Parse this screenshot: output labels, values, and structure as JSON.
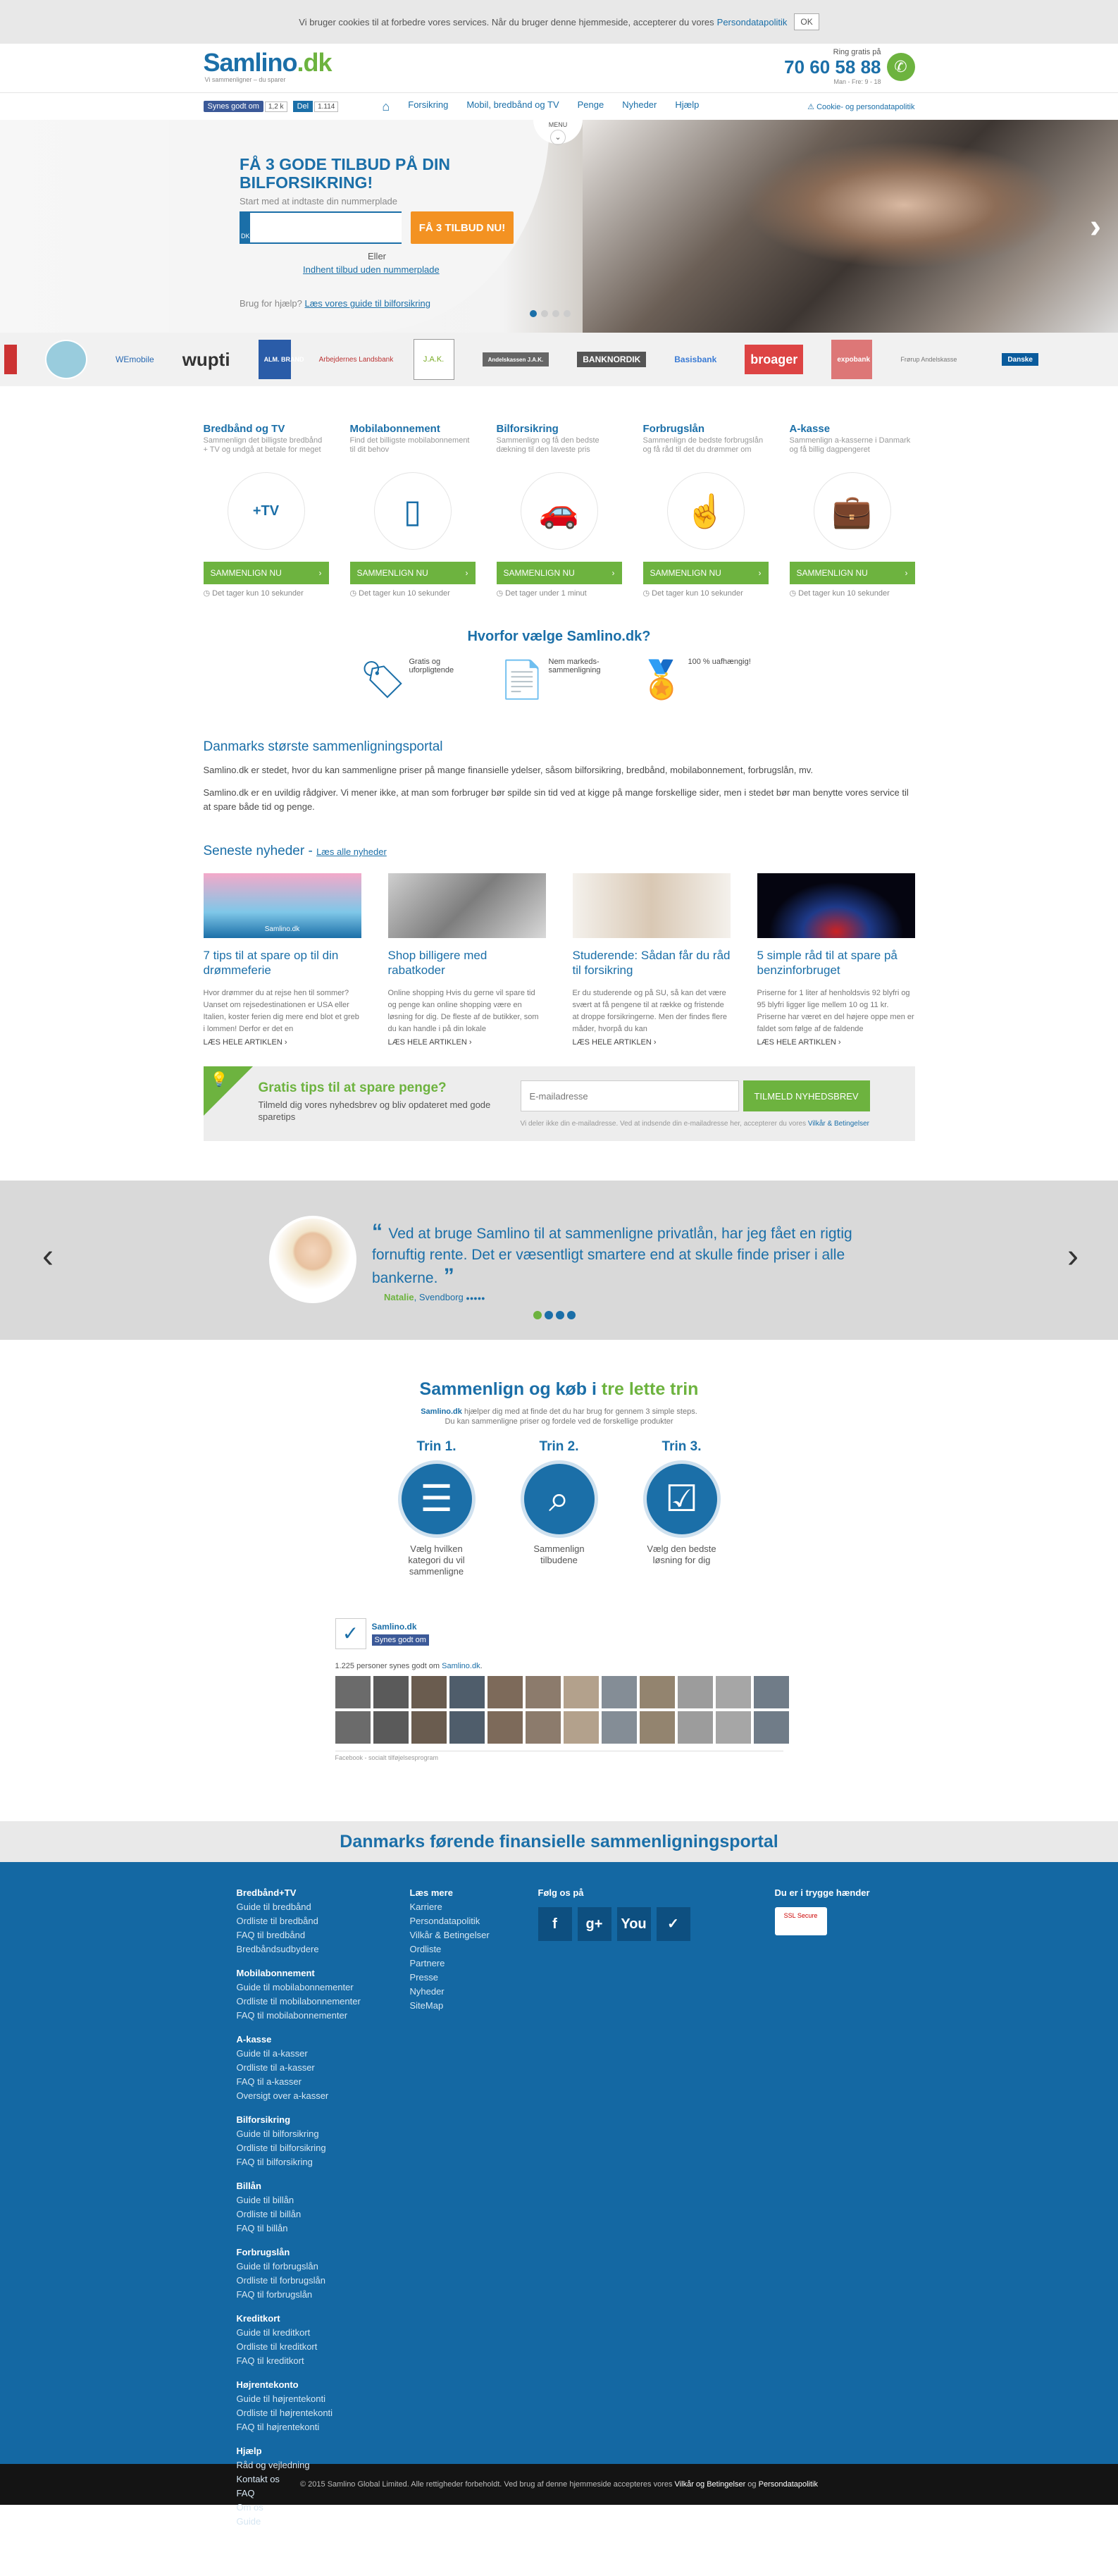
{
  "cookie_bar": {
    "text": "Vi bruger cookies til at forbedre vores services. Når du bruger denne hjemmeside, accepterer du vores",
    "link": "Persondatapolitik",
    "ok": "OK"
  },
  "header": {
    "logo_main": "Samlino",
    "logo_tld": ".dk",
    "tagline": "Vi sammenligner – du sparer",
    "phone_label": "Ring gratis på",
    "phone": "70 60 58 88",
    "hours": "Man - Fre: 9 - 18"
  },
  "nav": {
    "fb_label": "Synes godt om",
    "fb_count": "1,2 k",
    "in_label": "Del",
    "in_count": "1.114",
    "items": [
      "Forsikring",
      "Mobil, bredbånd og TV",
      "Penge",
      "Nyheder",
      "Hjælp"
    ],
    "cookie_link": "Cookie- og persondatapolitik"
  },
  "hero": {
    "title": "FÅ 3 GODE TILBUD PÅ DIN BILFORSIKRING!",
    "subtitle": "Start med at indtaste din nummerplade",
    "plate_country": "DK",
    "cta": "FÅ 3 TILBUD NU!",
    "or": "Eller",
    "no_plate_link": "Indhent tilbud uden nummerplade",
    "help_prefix": "Brug for hjælp?",
    "help_link": "Læs vores guide til bilforsikring",
    "menu_tab": "MENU"
  },
  "partner_logos": [
    "WEmobile",
    "wupti",
    "ALM. BRAND",
    "Arbejdernes Landsbank",
    "J.A.K.",
    "Andelskassen J.A.K.",
    "BANKNORDIK",
    "Basisbank",
    "broager",
    "expobank",
    "Frørup Andelskasse",
    "Danske"
  ],
  "categories": [
    {
      "title": "Bredbånd og TV",
      "desc": "Sammenlign det billigste bredbånd + TV og undgå at betale for meget",
      "btn": "SAMMENLIGN NU",
      "time": "Det tager kun 10 sekunder",
      "icon": "wifi-tv-icon",
      "glyph": "+TV"
    },
    {
      "title": "Mobilabonnement",
      "desc": "Find det billigste mobilabonnement til dit behov",
      "btn": "SAMMENLIGN NU",
      "time": "Det tager kun 10 sekunder",
      "icon": "phone-icon",
      "glyph": "▯"
    },
    {
      "title": "Bilforsikring",
      "desc": "Sammenlign og få den bedste dækning til den laveste pris",
      "btn": "SAMMENLIGN NU",
      "time": "Det tager under 1 minut",
      "icon": "car-icon",
      "glyph": "🚗"
    },
    {
      "title": "Forbrugslån",
      "desc": "Sammenlign de bedste forbrugslån og få råd til det du drømmer om",
      "btn": "SAMMENLIGN NU",
      "time": "Det tager kun 10 sekunder",
      "icon": "hand-person-icon",
      "glyph": "☝"
    },
    {
      "title": "A-kasse",
      "desc": "Sammenlign a-kasserne i Danmark og få billig dagpengeret",
      "btn": "SAMMENLIGN NU",
      "time": "Det tager kun 10 sekunder",
      "icon": "briefcase-icon",
      "glyph": "💼"
    }
  ],
  "why": {
    "title": "Hvorfor vælge Samlino.dk?",
    "items": [
      {
        "text": "Gratis og uforpligtende",
        "icon": "gratis-tag-icon",
        "glyph": "🏷"
      },
      {
        "text": "Nem markeds-sammenligning",
        "icon": "documents-check-icon",
        "glyph": "📄"
      },
      {
        "text": "100 % uafhængig!",
        "icon": "ribbon-award-icon",
        "glyph": "🏅"
      }
    ]
  },
  "portal": {
    "title": "Danmarks største sammenligningsportal",
    "p1": "Samlino.dk er stedet, hvor du kan sammenligne priser på mange finansielle ydelser, såsom bilforsikring, bredbånd, mobilabonnement, forbrugslån, mv.",
    "p2": "Samlino.dk er en uvildig rådgiver. Vi mener ikke, at man som forbruger bør spilde sin tid ved at kigge på mange forskellige sider, men i stedet bør man benytte vores service til at spare både tid og penge."
  },
  "news": {
    "title": "Seneste nyheder",
    "all_link": "Læs alle nyheder",
    "items": [
      {
        "title": "7 tips til at spare op til din drømmeferie",
        "text": "Hvor drømmer du at rejse hen til sommer? Uanset om rejsedestinationen er USA eller Italien, koster ferien dig mere end blot et greb i lommen! Derfor er det en",
        "more": "LÆS HELE ARTIKLEN",
        "img_label": "Samlino.dk",
        "color": "#7fc7e8"
      },
      {
        "title": "Shop billigere med rabatkoder",
        "text": "Online shopping Hvis du gerne vil spare tid og penge kan online shopping være en løsning for dig. De fleste af de butikker, som du kan handle i på din lokale",
        "more": "LÆS HELE ARTIKLEN",
        "img_label": "",
        "color": "#9a9a9a"
      },
      {
        "title": "Studerende: Sådan får du råd til forsikring",
        "text": "Er du studerende og på SU, så kan det være svært at få pengene til at række og fristende at droppe forsikringerne. Men der findes flere måder, hvorpå du kan",
        "more": "LÆS HELE ARTIKLEN",
        "img_label": "",
        "color": "#d9d2c8"
      },
      {
        "title": "5 simple råd til at spare på benzinforbruget",
        "text": "Priserne for 1 liter af henholdsvis 92 blyfri og 95 blyfri ligger lige mellem 10 og 11 kr. Priserne har været en del højere oppe men er faldet som følge af de faldende",
        "more": "LÆS HELE ARTIKLEN",
        "img_label": "",
        "color": "#0a0a1a"
      }
    ]
  },
  "newsletter": {
    "title": "Gratis tips til at spare penge?",
    "text": "Tilmeld dig vores nyhedsbrev og bliv opdateret med gode sparetips",
    "placeholder": "E-mailadresse",
    "button": "TILMELD NYHEDSBREV",
    "fine": "Vi deler ikke din e-mailadresse. Ved at indsende din e-mailadresse her, accepterer du vores",
    "fine_link": "Vilkår & Betingelser"
  },
  "testimonial": {
    "quote": "Ved at bruge Samlino til at sammenligne privatlån, har jeg fået en rigtig fornuftig rente. Det er væsentligt smartere end at skulle finde priser i alle bankerne.",
    "name": "Natalie",
    "city": "Svendborg",
    "stars": "●●●●●"
  },
  "steps": {
    "title_a": "Sammenlign og køb i",
    "title_b": "tre lette trin",
    "brand": "Samlino.dk",
    "sub1": "hjælper dig med at finde det du har brug for gennem 3 simple steps.",
    "sub2": "Du kan sammenligne priser og fordele ved de forskellige produkter",
    "items": [
      {
        "title": "Trin 1.",
        "desc": "Vælg hvilken kategori du vil sammenligne",
        "icon": "checklist-icon",
        "glyph": "☰"
      },
      {
        "title": "Trin 2.",
        "desc": "Sammenlign tilbudene",
        "icon": "magnifier-icon",
        "glyph": "⌕"
      },
      {
        "title": "Trin 3.",
        "desc": "Vælg den bedste løsning for dig",
        "icon": "checkbox-icon",
        "glyph": "☑"
      }
    ]
  },
  "fb_widget": {
    "name": "Samlino.dk",
    "like": "Synes godt om",
    "count_text": "1.225 personer synes godt om",
    "count_link": "Samlino.dk",
    "plugin": "Facebook - socialt tilføjelsesprogram"
  },
  "footer": {
    "headline": "Danmarks førende finansielle sammenligningsportal",
    "col1": [
      {
        "h": "Bredbånd+TV",
        "links": [
          "Guide til bredbånd",
          "Ordliste til bredbånd",
          "FAQ til bredbånd",
          "Bredbåndsudbydere"
        ]
      },
      {
        "h": "Mobilabonnement",
        "links": [
          "Guide til mobilabonnementer",
          "Ordliste til mobilabonnementer",
          "FAQ til mobilabonnementer"
        ]
      },
      {
        "h": "A-kasse",
        "links": [
          "Guide til a-kasser",
          "Ordliste til a-kasser",
          "FAQ til a-kasser",
          "Oversigt over a-kasser"
        ]
      },
      {
        "h": "Bilforsikring",
        "links": [
          "Guide til bilforsikring",
          "Ordliste til bilforsikring",
          "FAQ til bilforsikring"
        ]
      },
      {
        "h": "Billån",
        "links": [
          "Guide til billån",
          "Ordliste til billån",
          "FAQ til billån"
        ]
      },
      {
        "h": "Forbrugslån",
        "links": [
          "Guide til forbrugslån",
          "Ordliste til forbrugslån",
          "FAQ til forbrugslån"
        ]
      },
      {
        "h": "Kreditkort",
        "links": [
          "Guide til kreditkort",
          "Ordliste til kreditkort",
          "FAQ til kreditkort"
        ]
      },
      {
        "h": "Højrentekonto",
        "links": [
          "Guide til højrentekonti",
          "Ordliste til højrentekonti",
          "FAQ til højrentekonti"
        ]
      },
      {
        "h": "Hjælp",
        "links": [
          "Råd og vejledning",
          "Kontakt os",
          "FAQ",
          "Om os",
          "Guide"
        ]
      }
    ],
    "col2": {
      "h": "Læs mere",
      "links": [
        "Karriere",
        "Persondatapolitik",
        "Vilkår & Betingelser",
        "Ordliste",
        "Partnere",
        "Presse",
        "Nyheder",
        "SiteMap"
      ]
    },
    "col3": {
      "h": "Følg os på",
      "social": [
        {
          "glyph": "f",
          "icon": "facebook-icon"
        },
        {
          "glyph": "g+",
          "icon": "google-plus-icon"
        },
        {
          "glyph": "You",
          "icon": "youtube-icon"
        },
        {
          "glyph": "✓",
          "icon": "blog-icon"
        }
      ]
    },
    "col4": {
      "h": "Du er i trygge hænder",
      "seal": "SSL Secure"
    }
  },
  "copyright": {
    "text": "© 2015 Samlino Global Limited. Alle rettigheder forbeholdt. Ved brug af denne hjemmeside accepteres vores",
    "link1": "Vilkår og Betingelser",
    "and": "og",
    "link2": "Persondatapolitik"
  }
}
